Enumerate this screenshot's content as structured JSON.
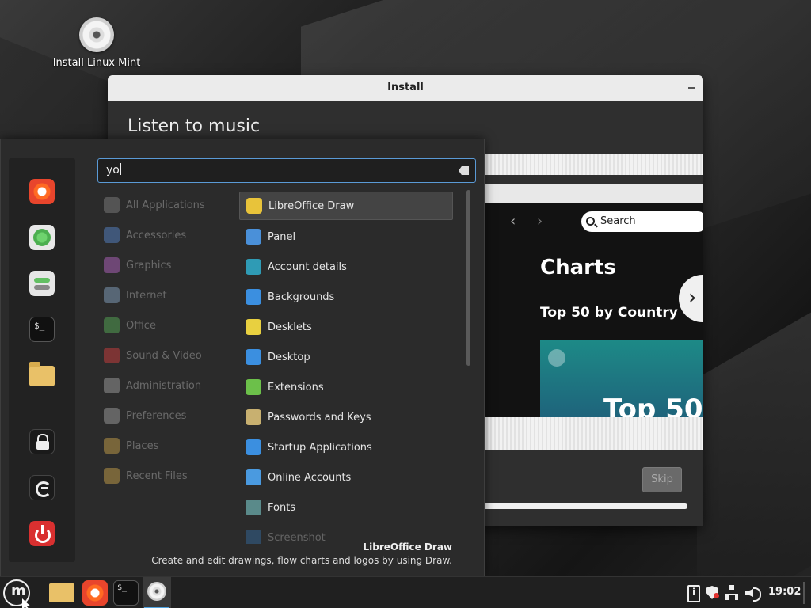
{
  "desktop": {
    "icon_label": "Install Linux Mint"
  },
  "install_window": {
    "title": "Install",
    "heading": "Listen to music",
    "spotify": {
      "search_placeholder": "Search",
      "section_title": "Charts",
      "subsection": "Top 50 by Country",
      "card_text": "Top 50"
    },
    "skip_label": "Skip"
  },
  "menu": {
    "search_value": "yo",
    "categories": [
      {
        "label": "All Applications",
        "icon": "grid-icon",
        "color": "#888888"
      },
      {
        "label": "Accessories",
        "icon": "accessories-icon",
        "color": "#5b8fd9"
      },
      {
        "label": "Graphics",
        "icon": "graphics-icon",
        "color": "#c06ad0"
      },
      {
        "label": "Internet",
        "icon": "internet-icon",
        "color": "#8fb0d0"
      },
      {
        "label": "Office",
        "icon": "office-icon",
        "color": "#5cb85c"
      },
      {
        "label": "Sound & Video",
        "icon": "sound-video-icon",
        "color": "#e04040"
      },
      {
        "label": "Administration",
        "icon": "administration-icon",
        "color": "#aaaaaa"
      },
      {
        "label": "Preferences",
        "icon": "preferences-icon",
        "color": "#aaaaaa"
      },
      {
        "label": "Places",
        "icon": "places-icon",
        "color": "#d8ac4e"
      },
      {
        "label": "Recent Files",
        "icon": "recent-files-icon",
        "color": "#d8ac4e"
      }
    ],
    "apps": [
      {
        "label": "LibreOffice Draw",
        "icon": "libreoffice-draw-icon",
        "color": "#e8c33a"
      },
      {
        "label": "Panel",
        "icon": "panel-icon",
        "color": "#4a90d9"
      },
      {
        "label": "Account details",
        "icon": "account-icon",
        "color": "#2f9bb5"
      },
      {
        "label": "Backgrounds",
        "icon": "backgrounds-icon",
        "color": "#3b8fe0"
      },
      {
        "label": "Desklets",
        "icon": "desklets-icon",
        "color": "#e8d040"
      },
      {
        "label": "Desktop",
        "icon": "desktop-icon",
        "color": "#3b8fe0"
      },
      {
        "label": "Extensions",
        "icon": "extensions-icon",
        "color": "#6cc04a"
      },
      {
        "label": "Passwords and Keys",
        "icon": "passwords-keys-icon",
        "color": "#c8b070"
      },
      {
        "label": "Startup Applications",
        "icon": "startup-apps-icon",
        "color": "#3b8fe0"
      },
      {
        "label": "Online Accounts",
        "icon": "online-accounts-icon",
        "color": "#4a9ae0"
      },
      {
        "label": "Fonts",
        "icon": "fonts-icon",
        "color": "#5a8a8a"
      },
      {
        "label": "Screenshot",
        "icon": "screenshot-icon",
        "color": "#3b8fe0"
      }
    ],
    "selected_title": "LibreOffice Draw",
    "selected_description": "Create and edit drawings, flow charts and logos by using Draw."
  },
  "panel": {
    "clock": "19:02"
  }
}
